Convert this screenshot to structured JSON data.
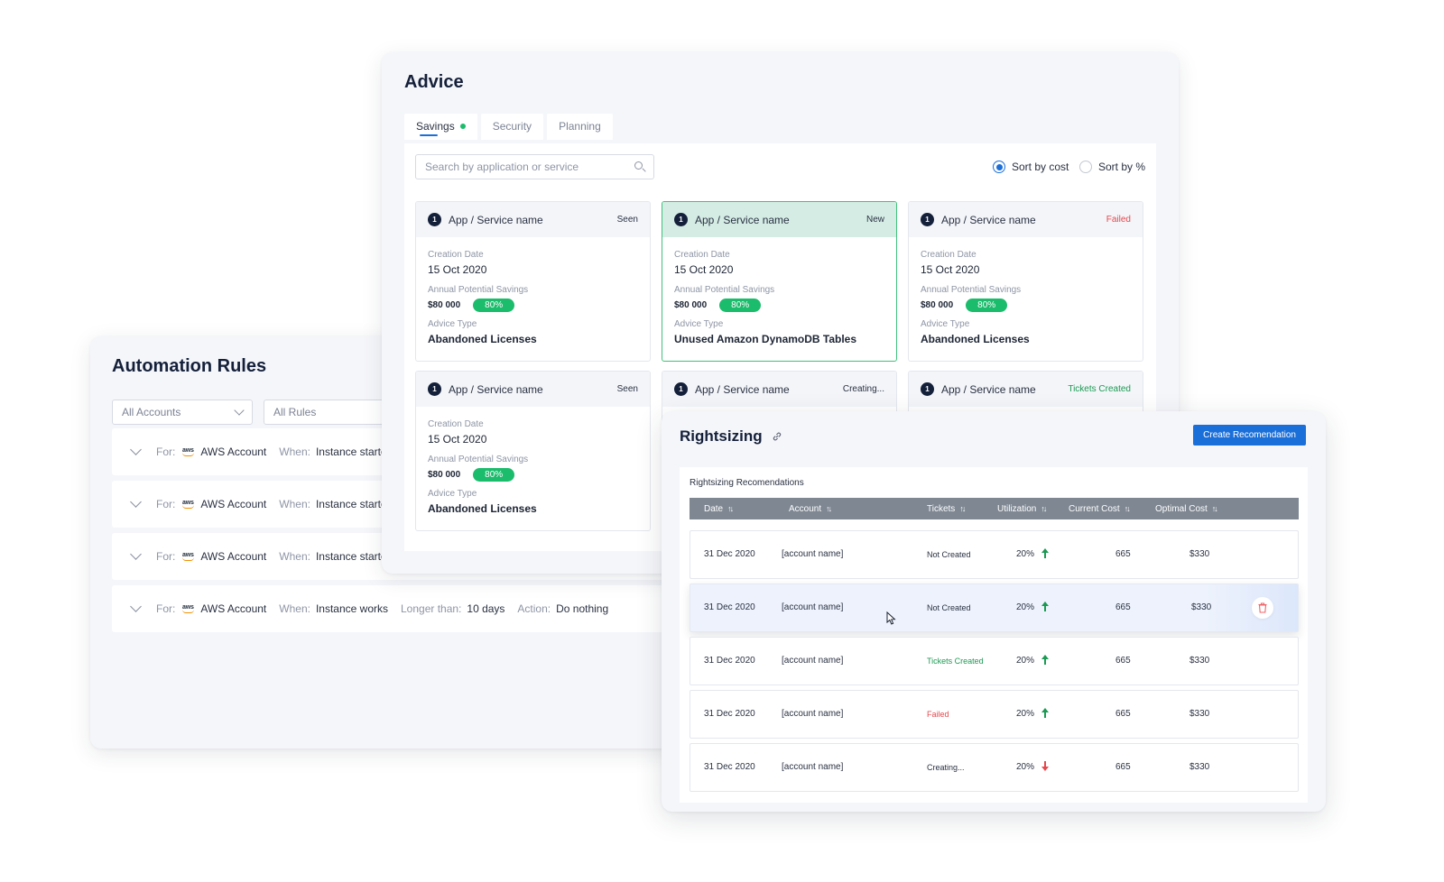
{
  "automation": {
    "title": "Automation Rules",
    "filters": {
      "accounts": "All Accounts",
      "rules": "All Rules"
    },
    "rules": [
      {
        "for_label": "For:",
        "account_icon": "aws-logo",
        "account": "AWS Account",
        "when_label": "When:",
        "when": "Instance started"
      },
      {
        "for_label": "For:",
        "account_icon": "aws-logo",
        "account": "AWS Account",
        "when_label": "When:",
        "when": "Instance started"
      },
      {
        "for_label": "For:",
        "account_icon": "aws-logo",
        "account": "AWS Account",
        "when_label": "When:",
        "when": "Instance started"
      },
      {
        "for_label": "For:",
        "account_icon": "aws-logo",
        "account": "AWS Account",
        "when_label": "When:",
        "when": "Instance works",
        "longer_label": "Longer than:",
        "longer": "10 days",
        "action_label": "Action:",
        "action": "Do nothing"
      }
    ],
    "aws_logo_text": "aws"
  },
  "advice": {
    "title": "Advice",
    "tabs": [
      {
        "label": "Savings",
        "active": true,
        "has_dot": true
      },
      {
        "label": "Security",
        "active": false
      },
      {
        "label": "Planning",
        "active": false
      }
    ],
    "search_placeholder": "Search by application or service",
    "sort_options": [
      {
        "label": "Sort by cost",
        "selected": true
      },
      {
        "label": "Sort by %",
        "selected": false
      }
    ],
    "cards": [
      {
        "index": "1",
        "name": "App / Service name",
        "status": "Seen",
        "creation_label": "Creation Date",
        "creation_date": "15 Oct 2020",
        "savings_label": "Annual Potential Savings",
        "savings": "$80 000",
        "savings_pct": "80%",
        "type_label": "Advice Type",
        "type": "Abandoned Licenses"
      },
      {
        "index": "1",
        "name": "App / Service name",
        "status": "New",
        "creation_label": "Creation Date",
        "creation_date": "15 Oct 2020",
        "savings_label": "Annual Potential Savings",
        "savings": "$80 000",
        "savings_pct": "80%",
        "type_label": "Advice Type",
        "type": "Unused Amazon DynamoDB Tables"
      },
      {
        "index": "1",
        "name": "App / Service name",
        "status": "Failed",
        "creation_label": "Creation Date",
        "creation_date": "15 Oct 2020",
        "savings_label": "Annual Potential Savings",
        "savings": "$80 000",
        "savings_pct": "80%",
        "type_label": "Advice Type",
        "type": "Abandoned Licenses"
      },
      {
        "index": "1",
        "name": "App / Service name",
        "status": "Seen",
        "creation_label": "Creation Date",
        "creation_date": "15 Oct 2020",
        "savings_label": "Annual Potential Savings",
        "savings": "$80 000",
        "savings_pct": "80%",
        "type_label": "Advice Type",
        "type": "Abandoned Licenses"
      },
      {
        "index": "1",
        "name": "App / Service name",
        "status": "Creating..."
      },
      {
        "index": "1",
        "name": "App / Service name",
        "status": "Tickets Created"
      }
    ]
  },
  "rightsizing": {
    "title": "Rightsizing",
    "create_button": "Create Recomendation",
    "table_title": "Rightsizing Recomendations",
    "columns": [
      "Date",
      "Account",
      "Tickets",
      "Utilization",
      "Current Cost",
      "Optimal Cost"
    ],
    "rows": [
      {
        "date": "31 Dec 2020",
        "account": "[account name]",
        "tickets": "Not Created",
        "tickets_status": "neutral",
        "utilization": "20%",
        "trend": "up",
        "current_cost": "665",
        "optimal_cost": "$330"
      },
      {
        "date": "31 Dec 2020",
        "account": "[account name]",
        "tickets": "Not Created",
        "tickets_status": "neutral",
        "utilization": "20%",
        "trend": "up",
        "current_cost": "665",
        "optimal_cost": "$330",
        "hovered": true
      },
      {
        "date": "31 Dec 2020",
        "account": "[account name]",
        "tickets": "Tickets Created",
        "tickets_status": "success",
        "utilization": "20%",
        "trend": "up",
        "current_cost": "665",
        "optimal_cost": "$330"
      },
      {
        "date": "31 Dec 2020",
        "account": "[account name]",
        "tickets": "Failed",
        "tickets_status": "error",
        "utilization": "20%",
        "trend": "up",
        "current_cost": "665",
        "optimal_cost": "$330"
      },
      {
        "date": "31 Dec 2020",
        "account": "[account name]",
        "tickets": "Creating...",
        "tickets_status": "neutral",
        "utilization": "20%",
        "trend": "down",
        "current_cost": "665",
        "optimal_cost": "$330"
      }
    ]
  },
  "colors": {
    "accent": "#1d6fd8",
    "success": "#1bbc6b",
    "error": "#e5484d",
    "title": "#14203a",
    "table_header": "#7e8792"
  }
}
